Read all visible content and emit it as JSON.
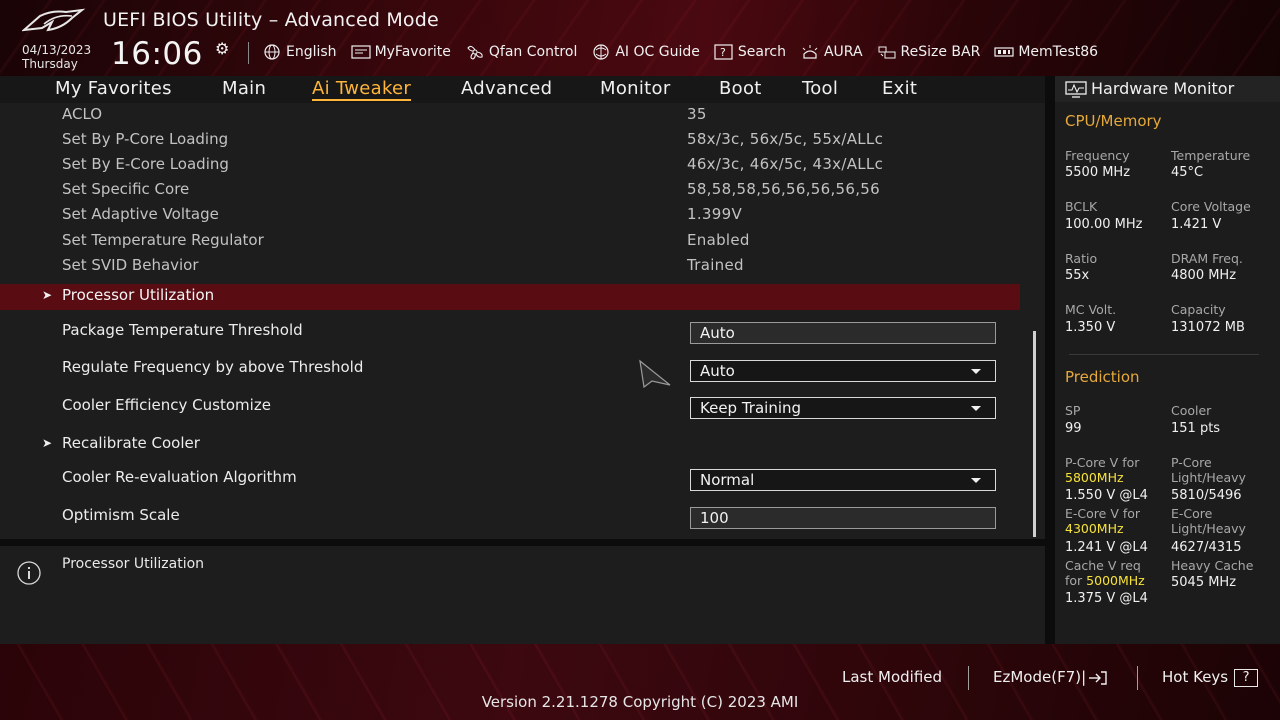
{
  "header": {
    "title": "UEFI BIOS Utility – Advanced Mode",
    "date": "04/13/2023",
    "day": "Thursday",
    "time": "16:06",
    "toolbar": [
      {
        "label": "English",
        "icon": "globe-icon"
      },
      {
        "label": "MyFavorite",
        "icon": "favorite-icon"
      },
      {
        "label": "Qfan Control",
        "icon": "fan-icon"
      },
      {
        "label": "AI OC Guide",
        "icon": "ai-oc-icon"
      },
      {
        "label": "Search",
        "icon": "search-icon"
      },
      {
        "label": "AURA",
        "icon": "aura-icon"
      },
      {
        "label": "ReSize BAR",
        "icon": "resize-bar-icon"
      },
      {
        "label": "MemTest86",
        "icon": "memtest-icon"
      }
    ]
  },
  "tabs": [
    {
      "label": "My Favorites"
    },
    {
      "label": "Main"
    },
    {
      "label": "Ai Tweaker",
      "active": true
    },
    {
      "label": "Advanced"
    },
    {
      "label": "Monitor"
    },
    {
      "label": "Boot"
    },
    {
      "label": "Tool"
    },
    {
      "label": "Exit"
    }
  ],
  "settings": {
    "info_rows": [
      {
        "label": "ACLO",
        "value": "35"
      },
      {
        "label": "Set By P-Core Loading",
        "value": "58x/3c, 56x/5c, 55x/ALLc"
      },
      {
        "label": "Set By E-Core Loading",
        "value": "46x/3c, 46x/5c, 43x/ALLc"
      },
      {
        "label": "Set Specific Core",
        "value": "58,58,58,56,56,56,56,56"
      },
      {
        "label": "Set Adaptive Voltage",
        "value": "1.399V"
      },
      {
        "label": "Set Temperature Regulator",
        "value": "Enabled"
      },
      {
        "label": "Set SVID Behavior",
        "value": "Trained"
      }
    ],
    "processor_utilization": "Processor Utilization",
    "package_temp": {
      "label": "Package Temperature Threshold",
      "value": "Auto"
    },
    "regulate_freq": {
      "label": "Regulate Frequency by above Threshold",
      "value": "Auto"
    },
    "cooler_eff": {
      "label": "Cooler Efficiency Customize",
      "value": "Keep Training"
    },
    "recalibrate": "Recalibrate Cooler",
    "reeval": {
      "label": "Cooler Re-evaluation Algorithm",
      "value": "Normal"
    },
    "optimism": {
      "label": "Optimism Scale",
      "value": "100"
    }
  },
  "help": {
    "text": "Processor Utilization"
  },
  "hw_monitor": {
    "title": "Hardware Monitor",
    "cpu_memory": {
      "heading": "CPU/Memory",
      "frequency": {
        "label": "Frequency",
        "value": "5500 MHz"
      },
      "temperature": {
        "label": "Temperature",
        "value": "45°C"
      },
      "bclk": {
        "label": "BCLK",
        "value": "100.00 MHz"
      },
      "core_voltage": {
        "label": "Core Voltage",
        "value": "1.421 V"
      },
      "ratio": {
        "label": "Ratio",
        "value": "55x"
      },
      "dram_freq": {
        "label": "DRAM Freq.",
        "value": "4800 MHz"
      },
      "mc_volt": {
        "label": "MC Volt.",
        "value": "1.350 V"
      },
      "capacity": {
        "label": "Capacity",
        "value": "131072 MB"
      }
    },
    "prediction": {
      "heading": "Prediction",
      "sp": {
        "label": "SP",
        "value": "99"
      },
      "cooler": {
        "label": "Cooler",
        "value": "151 pts"
      },
      "pcore_v_label": "P-Core V for",
      "pcore_v_freq": "5800MHz",
      "pcore_v_value": "1.550 V @L4",
      "pcore_lh_label1": "P-Core",
      "pcore_lh_label2": "Light/Heavy",
      "pcore_lh_value": "5810/5496",
      "ecore_v_label": "E-Core V for",
      "ecore_v_freq": "4300MHz",
      "ecore_v_value": "1.241 V @L4",
      "ecore_lh_label1": "E-Core",
      "ecore_lh_label2": "Light/Heavy",
      "ecore_lh_value": "4627/4315",
      "cache_v_label1": "Cache V req",
      "cache_v_label2": "for",
      "cache_v_freq": "5000MHz",
      "cache_v_value": "1.375 V @L4",
      "heavy_cache_label": "Heavy Cache",
      "heavy_cache_value": "5045 MHz"
    }
  },
  "footer": {
    "last_modified": "Last Modified",
    "ezmode": "EzMode(F7)|",
    "hot_keys": "Hot Keys",
    "hot_keys_key": "?",
    "version": "Version 2.21.1278 Copyright (C) 2023 AMI"
  }
}
